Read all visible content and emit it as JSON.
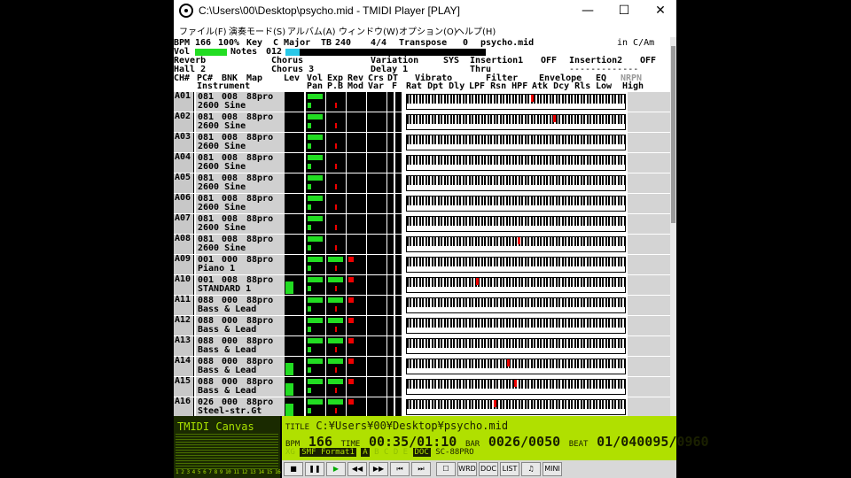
{
  "window": {
    "title": "C:\\Users\\00\\Desktop\\psycho.mid - TMIDI Player [PLAY]",
    "minimize": "—",
    "maximize": "☐",
    "close": "✕"
  },
  "menu": [
    "ファイル(F)",
    "演奏モード(S)",
    "アルバム(A)",
    "ウィンドウ(W)",
    "オプション(O)",
    "ヘルプ(H)"
  ],
  "header": {
    "bpm_label": "BPM",
    "bpm": "166",
    "percent": "100%",
    "key_label": "Key",
    "key": "C Major",
    "tb_label": "TB",
    "tb": "240",
    "time_sig": "4/4",
    "transpose_label": "Transpose",
    "transpose": "0",
    "filename": "psycho.mid",
    "in_c_am": "in C/Am",
    "vol_label": "Vol",
    "notes_label": "Notes",
    "notes": "012",
    "reverb_label": "Reverb",
    "reverb": "Hall 2",
    "chorus_label": "Chorus",
    "chorus": "Chorus 3",
    "variation_label": "Variation",
    "variation_mode": "SYS",
    "variation": "Delay 1",
    "insertion1_label": "Insertion1",
    "insertion1": "OFF",
    "insertion1_value": "Thru",
    "insertion2_label": "Insertion2",
    "insertion2": "OFF",
    "insertion2_value": "-------------"
  },
  "columns": {
    "ch": "CH#",
    "pc": "PC#",
    "bnk": "BNK",
    "map": "Map",
    "instrument": "Instrument",
    "lev": "Lev",
    "vol": "Vol",
    "pan": "Pan",
    "exp": "Exp",
    "pb": "P.B",
    "rev": "Rev",
    "mod": "Mod",
    "crs": "Crs",
    "var": "Var",
    "dt": "DT",
    "f": "F",
    "vibrato": "Vibrato",
    "vib_sub": "Rat Dpt Dly",
    "filter": "Filter",
    "filter_sub": "LPF Rsn HPF",
    "envelope": "Envelope",
    "env_sub": "Atk Dcy Rls",
    "eq": "EQ",
    "eq_sub": "Low",
    "nrpn": "NRPN",
    "high": "High"
  },
  "channels": [
    {
      "ch": "A01",
      "pc": "081",
      "bnk": "008",
      "map": "88pro",
      "inst": "2600 Sine",
      "lev": 0,
      "vol": 0.85,
      "exp": 0,
      "rev": 0,
      "note": 0.57
    },
    {
      "ch": "A02",
      "pc": "081",
      "bnk": "008",
      "map": "88pro",
      "inst": "2600 Sine",
      "lev": 0,
      "vol": 0.85,
      "exp": 0,
      "rev": 0,
      "note": 0.67
    },
    {
      "ch": "A03",
      "pc": "081",
      "bnk": "008",
      "map": "88pro",
      "inst": "2600 Sine",
      "lev": 0,
      "vol": 0.85,
      "exp": 0,
      "rev": 0,
      "note": null
    },
    {
      "ch": "A04",
      "pc": "081",
      "bnk": "008",
      "map": "88pro",
      "inst": "2600 Sine",
      "lev": 0,
      "vol": 0.85,
      "exp": 0,
      "rev": 0,
      "note": null
    },
    {
      "ch": "A05",
      "pc": "081",
      "bnk": "008",
      "map": "88pro",
      "inst": "2600 Sine",
      "lev": 0,
      "vol": 0.85,
      "exp": 0,
      "rev": 0,
      "note": null
    },
    {
      "ch": "A06",
      "pc": "081",
      "bnk": "008",
      "map": "88pro",
      "inst": "2600 Sine",
      "lev": 0,
      "vol": 0.85,
      "exp": 0,
      "rev": 0,
      "note": null
    },
    {
      "ch": "A07",
      "pc": "081",
      "bnk": "008",
      "map": "88pro",
      "inst": "2600 Sine",
      "lev": 0,
      "vol": 0.85,
      "exp": 0,
      "rev": 0,
      "note": null
    },
    {
      "ch": "A08",
      "pc": "081",
      "bnk": "008",
      "map": "88pro",
      "inst": "2600 Sine",
      "lev": 0,
      "vol": 0.85,
      "exp": 0,
      "rev": 0,
      "note": 0.51
    },
    {
      "ch": "A09",
      "pc": "001",
      "bnk": "000",
      "map": "88pro",
      "inst": "Piano 1",
      "lev": 0,
      "vol": 0.85,
      "exp": 0.85,
      "rev": 0.3,
      "note": null
    },
    {
      "ch": "A10",
      "pc": "001",
      "bnk": "008",
      "map": "88pro",
      "inst": "STANDARD 1",
      "lev": 0.7,
      "vol": 0.85,
      "exp": 0.85,
      "rev": 0.3,
      "note": 0.32
    },
    {
      "ch": "A11",
      "pc": "088",
      "bnk": "000",
      "map": "88pro",
      "inst": "Bass & Lead",
      "lev": 0,
      "vol": 0.85,
      "exp": 0.85,
      "rev": 0.3,
      "note": null
    },
    {
      "ch": "A12",
      "pc": "088",
      "bnk": "000",
      "map": "88pro",
      "inst": "Bass & Lead",
      "lev": 0,
      "vol": 0.85,
      "exp": 0.85,
      "rev": 0.3,
      "note": null
    },
    {
      "ch": "A13",
      "pc": "088",
      "bnk": "000",
      "map": "88pro",
      "inst": "Bass & Lead",
      "lev": 0,
      "vol": 0.85,
      "exp": 0.85,
      "rev": 0.3,
      "note": null
    },
    {
      "ch": "A14",
      "pc": "088",
      "bnk": "000",
      "map": "88pro",
      "inst": "Bass & Lead",
      "lev": 0.7,
      "vol": 0.85,
      "exp": 0.85,
      "rev": 0.3,
      "note": 0.46
    },
    {
      "ch": "A15",
      "pc": "088",
      "bnk": "000",
      "map": "88pro",
      "inst": "Bass & Lead",
      "lev": 0.7,
      "vol": 0.85,
      "exp": 0.85,
      "rev": 0.3,
      "note": 0.49
    },
    {
      "ch": "A16",
      "pc": "026",
      "bnk": "000",
      "map": "88pro",
      "inst": "Steel-str.Gt",
      "lev": 0.7,
      "vol": 0.85,
      "exp": 0.85,
      "rev": 0.3,
      "note": 0.4
    }
  ],
  "tmidi": {
    "title": "TMIDI Canvas",
    "channel_numbers": "1 2 3 4 5 6 7 8 9 10 11 12 13 14 15 16"
  },
  "lcd": {
    "title_label": "TITLE",
    "title": "C:¥Users¥00¥Desktop¥psycho.mid",
    "bpm_label": "BPM",
    "bpm": "166",
    "time_label": "TIME",
    "time": "00:35/01:10",
    "bar_label": "BAR",
    "bar": "0026/0050",
    "beat_label": "BEAT",
    "beat": "01/0400",
    "tick": "95/0960",
    "xg": "XG",
    "format": "SMF Format1",
    "port_a": "A",
    "ports_dim": "B C D E",
    "doc": "DOC",
    "module": "SC-88PRO"
  },
  "controls": [
    "■",
    "❚❚",
    "▶",
    "◀◀",
    "▶▶",
    "⏮",
    "⏭",
    "☐",
    "WRD",
    "DOC",
    "LIST",
    "♫",
    "MINI"
  ]
}
